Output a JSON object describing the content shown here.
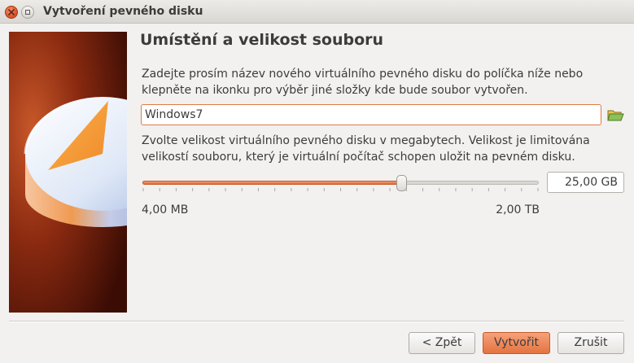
{
  "window": {
    "title": "Vytvoření pevného disku"
  },
  "page": {
    "heading": "Umístění a velikost souboru",
    "description1": "Zadejte prosím název nového virtuálního pevného disku do políčka níže nebo klepněte na ikonku pro výběr jiné složky kde bude soubor vytvořen.",
    "description2": "Zvolte velikost virtuálního pevného disku v megabytech. Velikost je limitována velikostí souboru, který je virtuální počítač schopen uložit na pevném disku."
  },
  "file": {
    "name_value": "Windows7"
  },
  "size": {
    "value_text": "25,00 GB",
    "slider_fraction": 0.655,
    "min_label": "4,00 MB",
    "max_label": "2,00 TB"
  },
  "buttons": {
    "back": "< Zpět",
    "create": "Vytvořit",
    "cancel": "Zrušit"
  },
  "icons": {
    "close": "close-icon",
    "minimize": "minimize-icon",
    "folder": "folder-open-icon",
    "wizard": "hard-disk-wizard-image"
  },
  "colors": {
    "accent": "#e4743f",
    "input_border": "#e07a46"
  }
}
